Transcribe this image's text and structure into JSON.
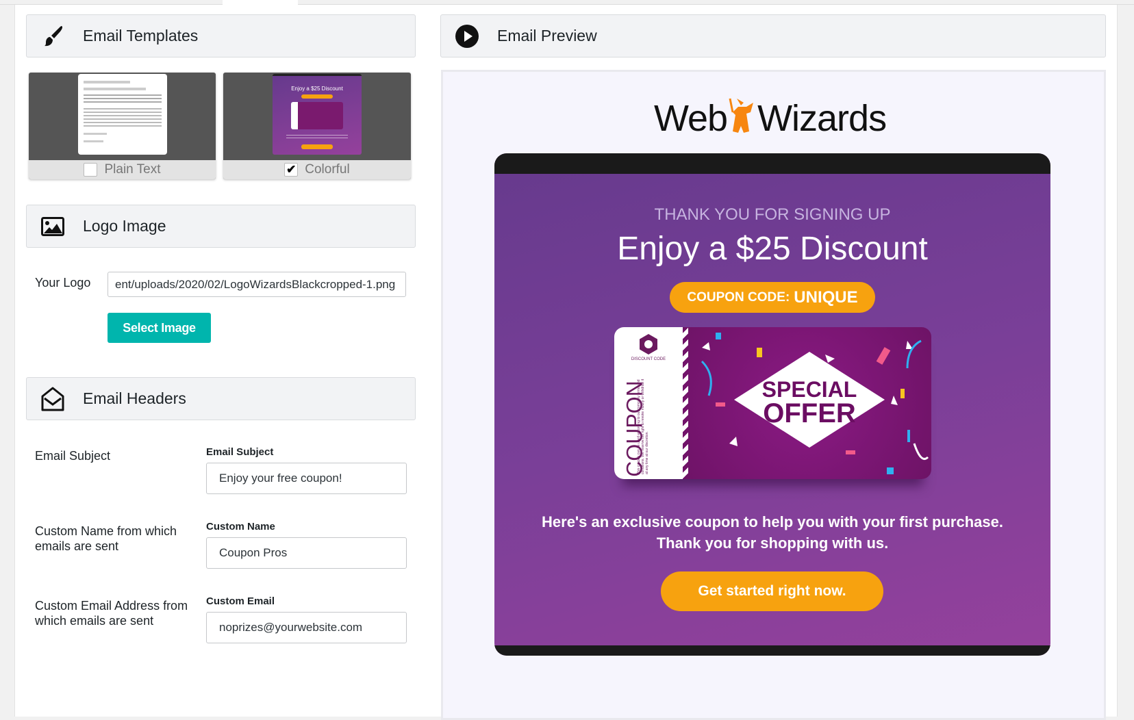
{
  "sections": {
    "templates": {
      "title": "Email Templates",
      "icon": "paintbrush-icon"
    },
    "logo": {
      "title": "Logo Image",
      "icon": "image-icon"
    },
    "headers": {
      "title": "Email Headers",
      "icon": "envelope-open-icon"
    },
    "preview": {
      "title": "Email Preview",
      "icon": "play-circle-icon"
    }
  },
  "templates": [
    {
      "label": "Plain Text",
      "checked": false
    },
    {
      "label": "Colorful",
      "checked": true
    }
  ],
  "logo_form": {
    "label": "Your Logo",
    "value": "ent/uploads/2020/02/LogoWizardsBlackcropped-1.png",
    "button": "Select Image"
  },
  "headers_form": [
    {
      "label": "Email Subject",
      "field_label": "Email Subject",
      "value": "Enjoy your free coupon!"
    },
    {
      "label": "Custom Name from which emails are sent",
      "field_label": "Custom Name",
      "value": "Coupon Pros"
    },
    {
      "label": "Custom Email Address from which emails are sent",
      "field_label": "Custom Email",
      "value": "noprizes@yourwebsite.com"
    }
  ],
  "email": {
    "brand_left": "Web",
    "brand_right": "Wizards",
    "kicker": "THANK YOU FOR SIGNING UP",
    "headline": "Enjoy a $25 Discount",
    "coupon_prefix": "COUPON CODE:",
    "coupon_code": "UNIQUE",
    "coupon_image": {
      "side": "COUPON",
      "small": "DISCOUNT CODE",
      "terms": "This coupon can be used according to our company terms and conditions. We reserve the right to revoke modify or withdraw it at any time at our discretion.",
      "line1": "SPECIAL",
      "line2": "OFFER"
    },
    "body_line1": "Here's an exclusive coupon to help you with your first purchase.",
    "body_line2": "Thank you for shopping with us.",
    "cta": "Get started right now."
  },
  "colors": {
    "accent": "#00b5ad",
    "orange": "#f7a20f",
    "purple": "#7a3f98"
  }
}
